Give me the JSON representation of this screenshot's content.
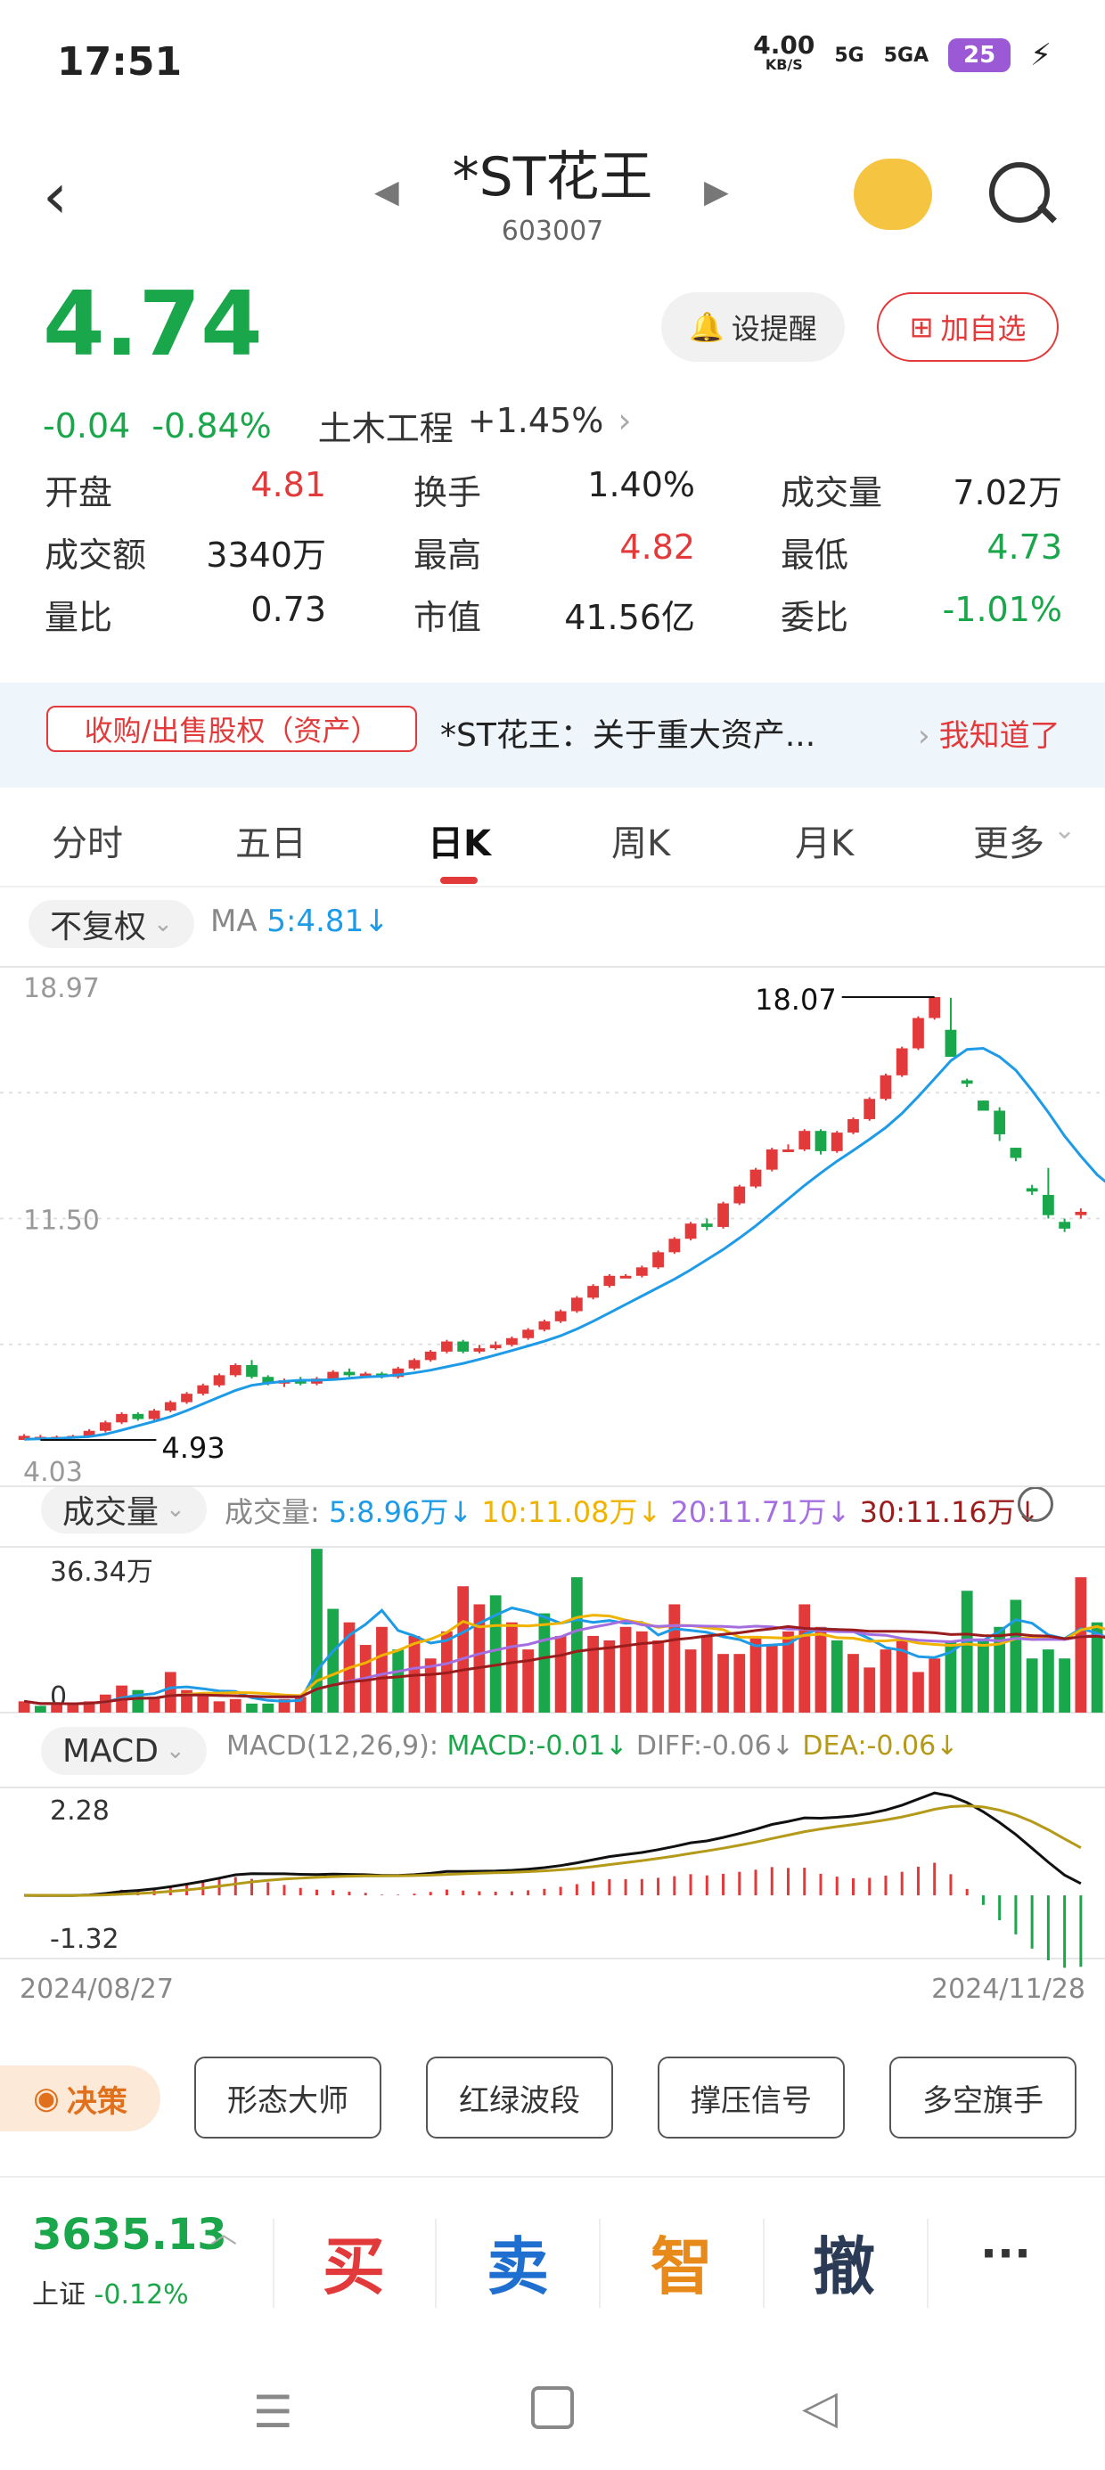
{
  "status_bar": {
    "time": "17:51",
    "speed": "4.00",
    "speed_unit": "KB/S",
    "network": "5G",
    "network2": "5GA",
    "battery": "25"
  },
  "header": {
    "name": "*ST花王",
    "code": "603007"
  },
  "price": {
    "current": "4.74",
    "change": "-0.04",
    "change_pct": "-0.84%",
    "sector": "土木工程",
    "sector_change": "+1.45%",
    "alert_label": "设提醒",
    "watch_label": "加自选"
  },
  "stats": [
    {
      "label": "开盘",
      "value": "4.81",
      "color": "red"
    },
    {
      "label": "换手",
      "value": "1.40%",
      "color": "black"
    },
    {
      "label": "成交量",
      "value": "7.02万",
      "color": "black"
    },
    {
      "label": "成交额",
      "value": "3340万",
      "color": "black"
    },
    {
      "label": "最高",
      "value": "4.82",
      "color": "red"
    },
    {
      "label": "最低",
      "value": "4.73",
      "color": "green"
    },
    {
      "label": "量比",
      "value": "0.73",
      "color": "black"
    },
    {
      "label": "市值",
      "value": "41.56亿",
      "color": "black"
    },
    {
      "label": "委比",
      "value": "-1.01%",
      "color": "green"
    }
  ],
  "banner": {
    "tag": "收购/出售股权（资产）",
    "text": "*ST花王：关于重大资产...",
    "ack": "我知道了"
  },
  "tabs": [
    "分时",
    "五日",
    "日K",
    "周K",
    "月K",
    "更多"
  ],
  "kline": {
    "adjust_label": "不复权",
    "ma_label": "MA",
    "ma_value": "5:4.81↓",
    "y_top": "18.97",
    "y_mid": "11.50",
    "y_bottom": "4.03",
    "high_mark": "18.07",
    "low_mark": "4.93",
    "ylim": [
      4.03,
      18.97
    ],
    "candles": [
      [
        4.93,
        5.05,
        4.93,
        5.1
      ],
      [
        5.02,
        5.02,
        4.95,
        5.08
      ],
      [
        5.0,
        5.02,
        4.96,
        5.06
      ],
      [
        5.02,
        5.05,
        4.98,
        5.08
      ],
      [
        5.05,
        5.2,
        5.02,
        5.25
      ],
      [
        5.2,
        5.45,
        5.15,
        5.5
      ],
      [
        5.45,
        5.7,
        5.4,
        5.75
      ],
      [
        5.7,
        5.55,
        5.5,
        5.75
      ],
      [
        5.55,
        5.8,
        5.5,
        5.85
      ],
      [
        5.8,
        6.05,
        5.75,
        6.1
      ],
      [
        6.05,
        6.3,
        6.0,
        6.35
      ],
      [
        6.3,
        6.55,
        6.25,
        6.6
      ],
      [
        6.55,
        6.85,
        6.5,
        6.9
      ],
      [
        6.85,
        7.15,
        6.8,
        7.2
      ],
      [
        7.15,
        6.8,
        6.75,
        7.3
      ],
      [
        6.8,
        6.6,
        6.55,
        6.85
      ],
      [
        6.6,
        6.7,
        6.5,
        6.75
      ],
      [
        6.7,
        6.6,
        6.55,
        6.8
      ],
      [
        6.6,
        6.75,
        6.55,
        6.8
      ],
      [
        6.75,
        6.95,
        6.7,
        7.0
      ],
      [
        6.95,
        6.85,
        6.8,
        7.05
      ],
      [
        6.85,
        6.9,
        6.8,
        6.95
      ],
      [
        6.9,
        6.8,
        6.75,
        6.95
      ],
      [
        6.8,
        7.05,
        6.75,
        7.1
      ],
      [
        7.05,
        7.3,
        7.0,
        7.35
      ],
      [
        7.3,
        7.55,
        7.25,
        7.6
      ],
      [
        7.55,
        7.85,
        7.5,
        7.9
      ],
      [
        7.85,
        7.55,
        7.5,
        7.9
      ],
      [
        7.55,
        7.65,
        7.5,
        7.75
      ],
      [
        7.65,
        7.75,
        7.6,
        7.85
      ],
      [
        7.75,
        7.95,
        7.7,
        8.0
      ],
      [
        7.95,
        8.2,
        7.9,
        8.25
      ],
      [
        8.2,
        8.45,
        8.15,
        8.5
      ],
      [
        8.45,
        8.75,
        8.4,
        8.8
      ],
      [
        8.75,
        9.15,
        8.7,
        9.2
      ],
      [
        9.15,
        9.5,
        9.1,
        9.55
      ],
      [
        9.5,
        9.8,
        9.45,
        9.85
      ],
      [
        9.8,
        9.8,
        9.75,
        9.85
      ],
      [
        9.8,
        10.05,
        9.75,
        10.1
      ],
      [
        10.05,
        10.5,
        10.0,
        10.55
      ],
      [
        10.5,
        10.9,
        10.45,
        10.95
      ],
      [
        10.9,
        11.35,
        10.85,
        11.4
      ],
      [
        11.35,
        11.25,
        11.15,
        11.5
      ],
      [
        11.25,
        11.95,
        11.2,
        12.0
      ],
      [
        11.95,
        12.45,
        11.9,
        12.5
      ],
      [
        12.45,
        12.95,
        12.4,
        13.0
      ],
      [
        12.95,
        13.55,
        12.9,
        13.6
      ],
      [
        13.55,
        13.55,
        13.5,
        13.7
      ],
      [
        13.55,
        14.1,
        13.5,
        14.15
      ],
      [
        14.1,
        13.5,
        13.4,
        14.15
      ],
      [
        13.5,
        14.05,
        13.45,
        14.1
      ],
      [
        14.05,
        14.45,
        14.0,
        14.5
      ],
      [
        14.45,
        15.05,
        14.4,
        15.1
      ],
      [
        15.05,
        15.75,
        15.0,
        15.8
      ],
      [
        15.75,
        16.55,
        15.7,
        16.6
      ],
      [
        16.55,
        17.45,
        16.5,
        17.5
      ],
      [
        17.45,
        18.07,
        17.4,
        18.07
      ],
      [
        17.1,
        16.3,
        16.3,
        18.05
      ],
      [
        15.6,
        15.5,
        15.4,
        15.65
      ],
      [
        15.0,
        14.7,
        14.7,
        15.0
      ],
      [
        14.7,
        14.0,
        13.8,
        14.8
      ],
      [
        13.6,
        13.3,
        13.2,
        13.6
      ],
      [
        12.4,
        12.3,
        12.2,
        12.5
      ],
      [
        12.2,
        11.6,
        11.5,
        13.0
      ],
      [
        11.4,
        11.2,
        11.1,
        11.5
      ],
      [
        11.6,
        11.7,
        11.5,
        11.8
      ]
    ],
    "ma5": [
      4.95,
      4.96,
      4.97,
      5.0,
      5.03,
      5.1,
      5.22,
      5.35,
      5.48,
      5.62,
      5.8,
      6.0,
      6.2,
      6.4,
      6.55,
      6.62,
      6.67,
      6.7,
      6.7,
      6.72,
      6.76,
      6.8,
      6.82,
      6.86,
      6.92,
      7.0,
      7.1,
      7.2,
      7.32,
      7.45,
      7.58,
      7.72,
      7.86,
      8.02,
      8.22,
      8.45,
      8.7,
      8.95,
      9.2,
      9.45,
      9.7,
      9.98,
      10.28,
      10.58,
      10.92,
      11.28,
      11.68,
      12.08,
      12.48,
      12.85,
      13.2,
      13.52,
      13.85,
      14.2,
      14.62,
      15.12,
      15.65,
      16.18,
      16.52,
      16.55,
      16.3,
      15.9,
      15.3,
      14.65,
      13.95,
      13.35,
      12.8,
      12.4
    ]
  },
  "volume": {
    "selector": "成交量",
    "legend_prefix": "成交量:",
    "ma5": "5:8.96万↓",
    "ma10": "10:11.08万↓",
    "ma20": "20:11.71万↓",
    "ma30": "30:11.16万↓",
    "y_top": "36.34万",
    "y_zero": "0",
    "ylim": [
      0,
      36.34
    ],
    "values": [
      2.5,
      1.5,
      2.0,
      1.8,
      2.5,
      4.0,
      6.0,
      5.0,
      3.5,
      9.0,
      5.0,
      4.0,
      2.5,
      3.0,
      2.0,
      2.0,
      3.0,
      3.5,
      36.3,
      23.0,
      20.0,
      15.0,
      19.0,
      14.0,
      17.0,
      12.0,
      18.0,
      28.0,
      24.0,
      26.0,
      20.0,
      14.0,
      22.0,
      17.0,
      30.0,
      17.0,
      16.0,
      19.0,
      18.0,
      16.0,
      24.0,
      14.0,
      17.0,
      13.0,
      13.0,
      17.0,
      15.0,
      18.0,
      24.0,
      19.0,
      16.0,
      13.0,
      10.0,
      14.0,
      16.0,
      9.0,
      12.0,
      16.0,
      27.0,
      16.0,
      19.0,
      25.0,
      12.0,
      14.0,
      12.0,
      30.0,
      20.0,
      4.0
    ],
    "up": [
      1,
      0,
      1,
      1,
      1,
      1,
      1,
      0,
      1,
      1,
      1,
      1,
      1,
      1,
      0,
      0,
      1,
      1,
      0,
      0,
      1,
      1,
      1,
      0,
      1,
      1,
      1,
      1,
      1,
      0,
      1,
      1,
      0,
      1,
      0,
      1,
      1,
      1,
      1,
      1,
      1,
      1,
      1,
      1,
      1,
      1,
      1,
      1,
      1,
      1,
      0,
      1,
      1,
      1,
      1,
      1,
      1,
      0,
      0,
      0,
      0,
      0,
      0,
      0,
      0,
      1,
      0,
      1
    ]
  },
  "macd": {
    "selector": "MACD",
    "params": "MACD(12,26,9):",
    "macd_val": "MACD:-0.01↓",
    "diff_val": "DIFF:-0.06↓",
    "dea_val": "DEA:-0.06↓",
    "y_top": "2.28",
    "y_bottom": "-1.32",
    "ylim": [
      -1.32,
      2.28
    ]
  },
  "date_start": "2024/08/27",
  "date_end": "2024/11/28",
  "strategy": {
    "badge": "决策",
    "buttons": [
      "形态大师",
      "红绿波段",
      "撑压信号",
      "多空旗手"
    ]
  },
  "index": {
    "value": "3635.13",
    "name": "上证",
    "change": "-0.12%"
  },
  "actions": {
    "buy": "买",
    "sell": "卖",
    "smart": "智",
    "cancel": "撤",
    "more": "···"
  },
  "colors": {
    "up": "#e23a3a",
    "down": "#1aa64a",
    "ma5": "#1e9be6",
    "ma10": "#f0b400",
    "ma20": "#a46ee0",
    "ma30": "#9b1c1c",
    "diff": "#111111",
    "dea": "#b59a1a"
  }
}
